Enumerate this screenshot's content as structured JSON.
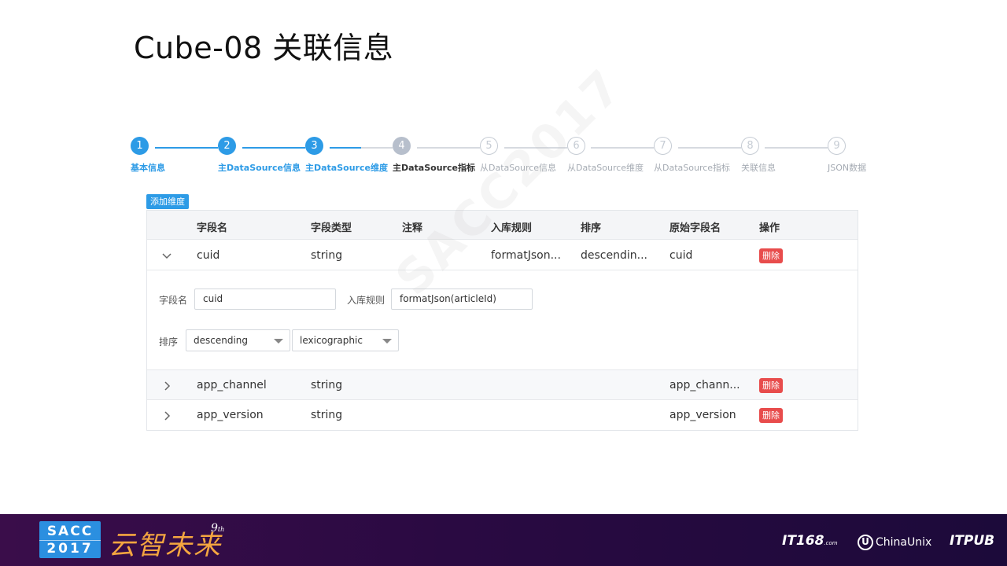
{
  "slide_title": "Cube-08 关联信息",
  "steps": [
    {
      "num": "1",
      "label": "基本信息",
      "state": "done"
    },
    {
      "num": "2",
      "label": "主DataSource信息",
      "state": "done"
    },
    {
      "num": "3",
      "label": "主DataSource维度",
      "state": "done"
    },
    {
      "num": "4",
      "label": "主DataSource指标",
      "state": "active"
    },
    {
      "num": "5",
      "label": "从DataSource信息",
      "state": "todo"
    },
    {
      "num": "6",
      "label": "从DataSource维度",
      "state": "todo"
    },
    {
      "num": "7",
      "label": "从DataSource指标",
      "state": "todo"
    },
    {
      "num": "8",
      "label": "关联信息",
      "state": "todo"
    },
    {
      "num": "9",
      "label": "JSON数据",
      "state": "todo"
    }
  ],
  "colors": {
    "accent": "#2d9be6",
    "delete": "#e84c4c",
    "footer": "#2a0a42"
  },
  "add_button_label": "添加维度",
  "table": {
    "headers": [
      "字段名",
      "字段类型",
      "注释",
      "入库规则",
      "排序",
      "原始字段名",
      "操作"
    ],
    "rows": [
      {
        "expanded": true,
        "name": "cuid",
        "type": "string",
        "comment": "",
        "rule": "formatJson...",
        "sort": "descendin...",
        "orig": "cuid",
        "action": "删除"
      },
      {
        "expanded": false,
        "name": "app_channel",
        "type": "string",
        "comment": "",
        "rule": "",
        "sort": "",
        "orig": "app_chann...",
        "action": "删除"
      },
      {
        "expanded": false,
        "name": "app_version",
        "type": "string",
        "comment": "",
        "rule": "",
        "sort": "",
        "orig": "app_version",
        "action": "删除"
      }
    ]
  },
  "expand_form": {
    "field_label": "字段名",
    "field_value": "cuid",
    "rule_label": "入库规则",
    "rule_value": "formatJson(articleId)",
    "sort_label": "排序",
    "sort_order": "descending",
    "sort_type": "lexicographic"
  },
  "icons": {
    "expanded": "chevron-down-icon",
    "collapsed": "chevron-right-icon",
    "dropdown": "caret-down-icon"
  },
  "watermark": "SACC2017",
  "footer": {
    "sacc_top": "SACC",
    "sacc_bottom": "2017",
    "slogan": "云智未来",
    "slogan_sup": "9",
    "slogan_sup_suffix": "th",
    "logo1": "IT168",
    "logo1_suffix": ".com",
    "logo2_mark": "U",
    "logo2": "ChinaUnix",
    "logo3": "ITPUB"
  }
}
